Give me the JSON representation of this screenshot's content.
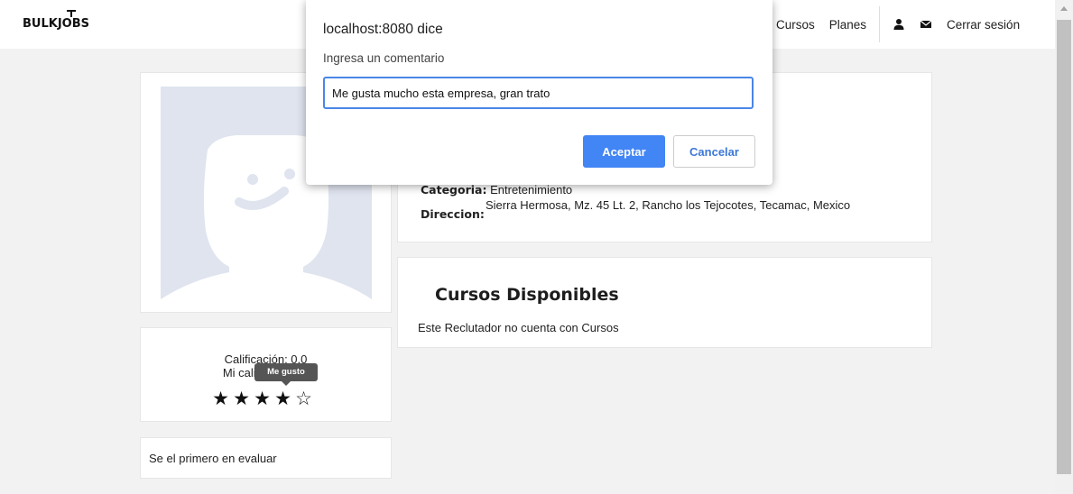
{
  "brand": {
    "logo_text": "BULKJOBS"
  },
  "nav": {
    "links": [
      "Cursos",
      "Planes"
    ],
    "logout": "Cerrar sesión",
    "icons": [
      "user-icon",
      "envelope-icon"
    ]
  },
  "company": {
    "categoria_label": "Categoria:",
    "categoria_value": "Entretenimiento",
    "direccion_label": "Direccion:",
    "direccion_value": "Sierra Hermosa, Mz. 45 Lt. 2, Rancho los Tejocotes, Tecamac, Mexico"
  },
  "rating": {
    "calificacion": "Calificación: 0.0",
    "mi_calificacion": "Mi calificación: 0",
    "stars": 5,
    "hover_stars": 4,
    "tooltip": "Me gusto"
  },
  "evaluations": {
    "empty_text": "Se el primero en evaluar"
  },
  "cursos": {
    "title": "Cursos Disponibles",
    "empty_text": "Este Reclutador no cuenta con Cursos"
  },
  "dialog": {
    "title": "localhost:8080 dice",
    "message": "Ingresa un comentario",
    "input_value": "Me gusta mucho esta empresa, gran trato",
    "ok_label": "Aceptar",
    "cancel_label": "Cancelar"
  },
  "colors": {
    "accent": "#4285f4",
    "avatar_bg": "#dfe4ef",
    "page_bg": "#f2f2f2"
  }
}
